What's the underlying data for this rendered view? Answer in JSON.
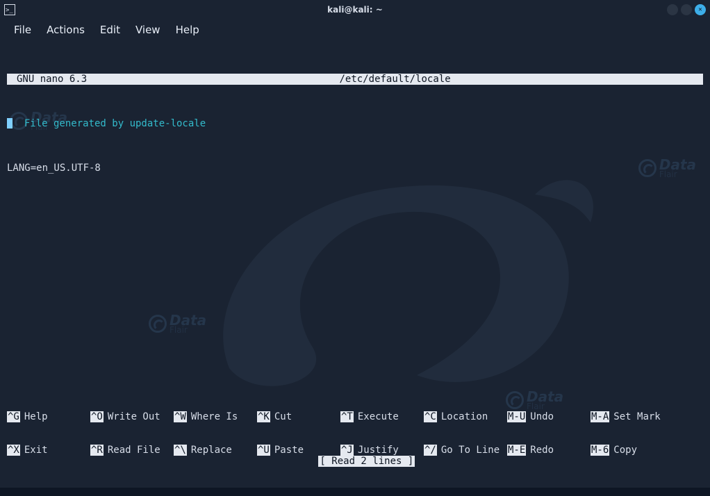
{
  "window": {
    "title": "kali@kali: ~",
    "controls": {
      "minimize": "minimize",
      "maximize": "maximize",
      "close": "close"
    }
  },
  "menubar": [
    "File",
    "Actions",
    "Edit",
    "View",
    "Help"
  ],
  "nano": {
    "app_label": "GNU nano 6.3",
    "file_path": "/etc/default/locale",
    "line1_comment": "  File generated by update-locale",
    "line2": "LANG=en_US.UTF-8",
    "status": "[ Read 2 lines ]"
  },
  "shortcuts_row1": [
    {
      "key": "^G",
      "label": "Help"
    },
    {
      "key": "^O",
      "label": "Write Out"
    },
    {
      "key": "^W",
      "label": "Where Is"
    },
    {
      "key": "^K",
      "label": "Cut"
    },
    {
      "key": "^T",
      "label": "Execute"
    },
    {
      "key": "^C",
      "label": "Location"
    },
    {
      "key": "M-U",
      "label": "Undo"
    },
    {
      "key": "M-A",
      "label": "Set Mark"
    }
  ],
  "shortcuts_row2": [
    {
      "key": "^X",
      "label": "Exit"
    },
    {
      "key": "^R",
      "label": "Read File"
    },
    {
      "key": "^\\",
      "label": "Replace"
    },
    {
      "key": "^U",
      "label": "Paste"
    },
    {
      "key": "^J",
      "label": "Justify"
    },
    {
      "key": "^/",
      "label": "Go To Line"
    },
    {
      "key": "M-E",
      "label": "Redo"
    },
    {
      "key": "M-6",
      "label": "Copy"
    }
  ],
  "watermark": {
    "brand": "Data",
    "sub": "Flair"
  }
}
